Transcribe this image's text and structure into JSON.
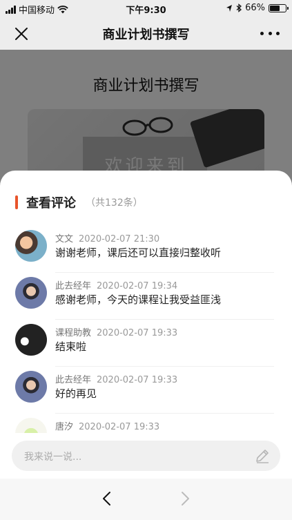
{
  "status_bar": {
    "carrier": "中国移动",
    "time": "下午9:30",
    "battery": "66%",
    "battery_level": 0.66
  },
  "nav": {
    "title": "商业计划书撰写",
    "close_icon": "close-icon",
    "more_icon": "more-icon"
  },
  "page": {
    "title": "商业计划书撰写",
    "banner_text": "欢迎来到"
  },
  "comments_panel": {
    "title": "查看评论",
    "count": "（共132条）",
    "accent_color": "#e8542b",
    "comments": [
      {
        "author": "文文",
        "time": "2020-02-07 21:30",
        "text": "谢谢老师，课后还可以直接归整收听"
      },
      {
        "author": "此去经年",
        "time": "2020-02-07 19:34",
        "text": "感谢老师，今天的课程让我受益匪浅"
      },
      {
        "author": "课程助教",
        "time": "2020-02-07 19:33",
        "text": "结束啦"
      },
      {
        "author": "此去经年",
        "time": "2020-02-07 19:33",
        "text": "好的再见"
      },
      {
        "author": "唐汐",
        "time": "2020-02-07 19:33",
        "text": ""
      }
    ],
    "input_placeholder": "我来说一说...",
    "input_icon": "pencil-icon"
  },
  "bottom_bar": {
    "back_icon": "chevron-left-icon",
    "forward_icon": "chevron-right-icon"
  }
}
